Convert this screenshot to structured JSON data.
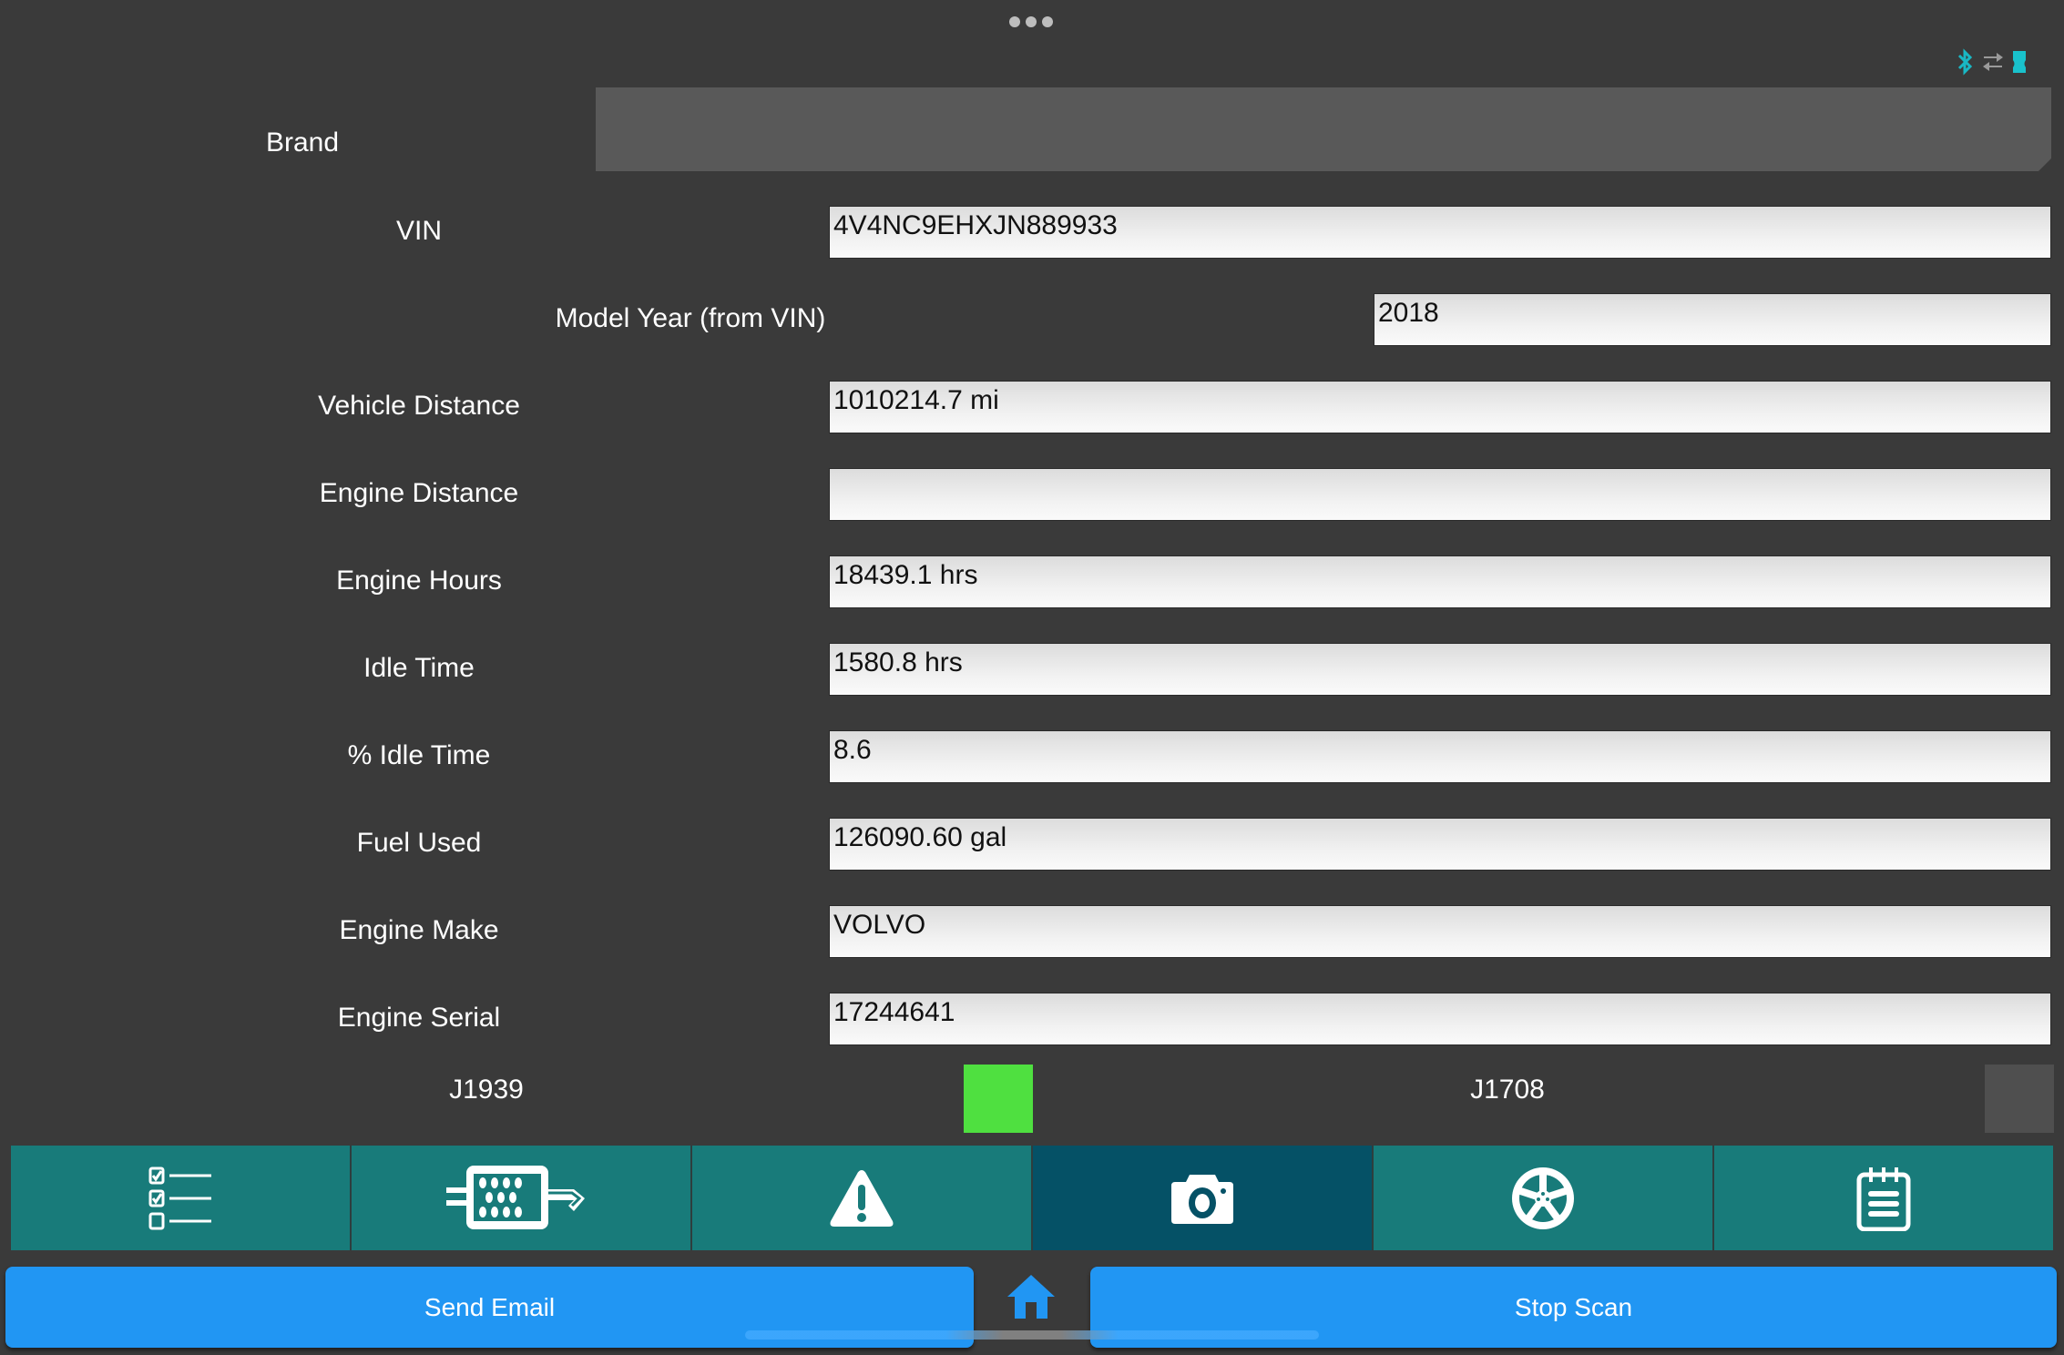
{
  "status_icons": [
    "bluetooth-icon",
    "transfer-icon",
    "device-icon"
  ],
  "brand": {
    "label": "Brand",
    "value": ""
  },
  "fields": [
    {
      "key": "vin",
      "label": "VIN",
      "value": "4V4NC9EHXJN889933"
    },
    {
      "key": "model_year",
      "label": "Model Year (from VIN)",
      "value": "2018"
    },
    {
      "key": "vehicle_distance",
      "label": "Vehicle Distance",
      "value": "1010214.7 mi"
    },
    {
      "key": "engine_distance",
      "label": "Engine Distance",
      "value": ""
    },
    {
      "key": "engine_hours",
      "label": "Engine Hours",
      "value": "18439.1 hrs"
    },
    {
      "key": "idle_time",
      "label": "Idle Time",
      "value": "1580.8 hrs"
    },
    {
      "key": "pct_idle_time",
      "label": "% Idle Time",
      "value": "8.6"
    },
    {
      "key": "fuel_used",
      "label": "Fuel Used",
      "value": "126090.60 gal"
    },
    {
      "key": "engine_make",
      "label": "Engine Make",
      "value": "VOLVO"
    },
    {
      "key": "engine_serial",
      "label": "Engine Serial",
      "value": "17244641"
    }
  ],
  "protocols": [
    {
      "label": "J1939",
      "active": true,
      "color": "#4fe040"
    },
    {
      "label": "J1708",
      "active": false,
      "color": "#4f4f4f"
    }
  ],
  "toolbar": {
    "items": [
      {
        "icon": "checklist-icon",
        "active": false
      },
      {
        "icon": "dpf-filter-icon",
        "active": false
      },
      {
        "icon": "warning-icon",
        "active": false
      },
      {
        "icon": "camera-icon",
        "active": true
      },
      {
        "icon": "wheel-icon",
        "active": false
      },
      {
        "icon": "notepad-icon",
        "active": false
      }
    ],
    "colors": {
      "normal": "#187b7a",
      "active": "#055166"
    }
  },
  "buttons": {
    "send_email": "Send Email",
    "stop_scan": "Stop Scan",
    "home_icon": "home-icon"
  },
  "accent": "#2196f3"
}
